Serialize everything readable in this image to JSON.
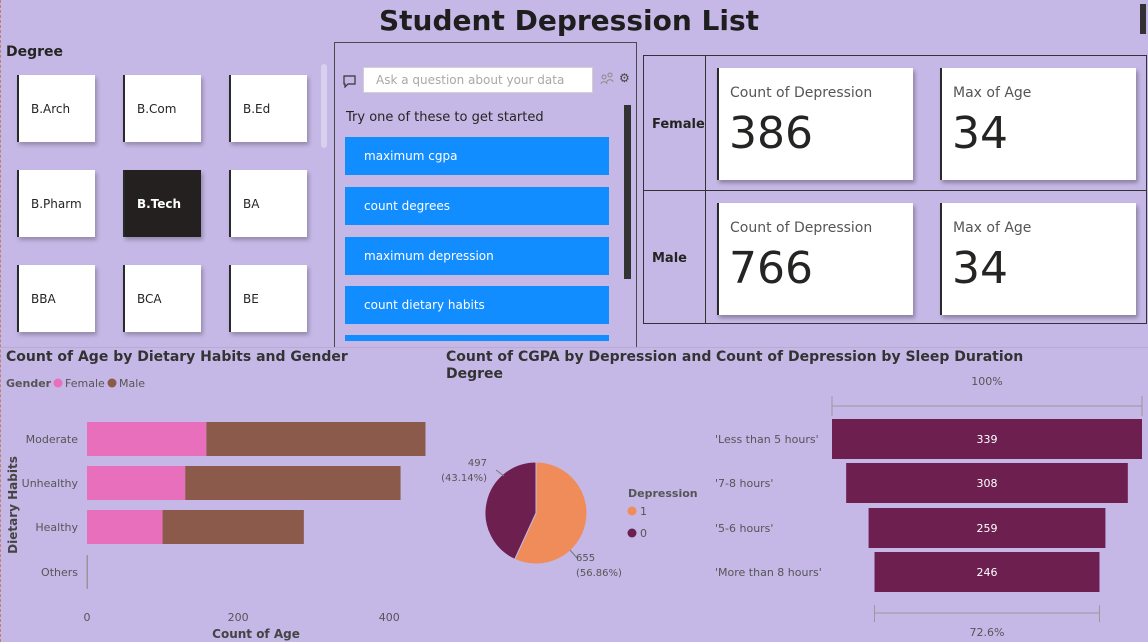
{
  "title": "Student Depression List",
  "degree_slicer": {
    "header": "Degree",
    "items": [
      "B.Arch",
      "B.Com",
      "B.Ed",
      "B.Pharm",
      "B.Tech",
      "BA",
      "BBA",
      "BCA",
      "BE"
    ],
    "selected": "B.Tech"
  },
  "qa": {
    "placeholder": "Ask a question about your data",
    "prompt": "Try one of these to get started",
    "suggestions": [
      "maximum cgpa",
      "count degrees",
      "maximum depression",
      "count dietary habits"
    ]
  },
  "matrix": {
    "rows": [
      {
        "gender": "Female",
        "count_label": "Count of Depression",
        "count_value": "386",
        "age_label": "Max of Age",
        "age_value": "34"
      },
      {
        "gender": "Male",
        "count_label": "Count of Depression",
        "count_value": "766",
        "age_label": "Max of Age",
        "age_value": "34"
      }
    ]
  },
  "visual_titles": {
    "dietary": "Count of Age by Dietary Habits and Gender",
    "cgpa_line1": "Count of CGPA by Depression and",
    "cgpa_line2": "Degree",
    "sleep": "Count of Depression by Sleep Duration"
  },
  "colors": {
    "female": "#e86fbc",
    "male": "#8b5a4a",
    "depression_1": "#f08c5a",
    "depression_0": "#6d1f4f",
    "funnel": "#6d1f4f",
    "qa_button": "#118dff"
  },
  "chart_data": [
    {
      "type": "bar",
      "orientation": "horizontal",
      "stacked": true,
      "legend_title": "Gender",
      "legend_position": "top-left",
      "categories": [
        "Moderate",
        "Unhealthy",
        "Healthy",
        "Others"
      ],
      "series": [
        {
          "name": "Female",
          "values": [
            158,
            130,
            100,
            0
          ]
        },
        {
          "name": "Male",
          "values": [
            290,
            285,
            187,
            1
          ]
        }
      ],
      "xlabel": "Count of Age",
      "ylabel": "Dietary Habits",
      "xticks": [
        "0",
        "200",
        "400"
      ],
      "xlim": [
        0,
        450
      ]
    },
    {
      "type": "pie",
      "donut": false,
      "legend_title": "Depression",
      "legend_position": "right",
      "slices": [
        {
          "name": "1",
          "value": 655,
          "label": "655",
          "percent_label": "(56.86%)"
        },
        {
          "name": "0",
          "value": 497,
          "label": "497",
          "percent_label": "(43.14%)"
        }
      ]
    },
    {
      "type": "funnel",
      "categories": [
        "'Less than 5 hours'",
        "'7-8 hours'",
        "'5-6 hours'",
        "'More than 8 hours'"
      ],
      "values": [
        339,
        308,
        259,
        246
      ],
      "top_label": "100%",
      "bottom_label": "72.6%"
    }
  ]
}
